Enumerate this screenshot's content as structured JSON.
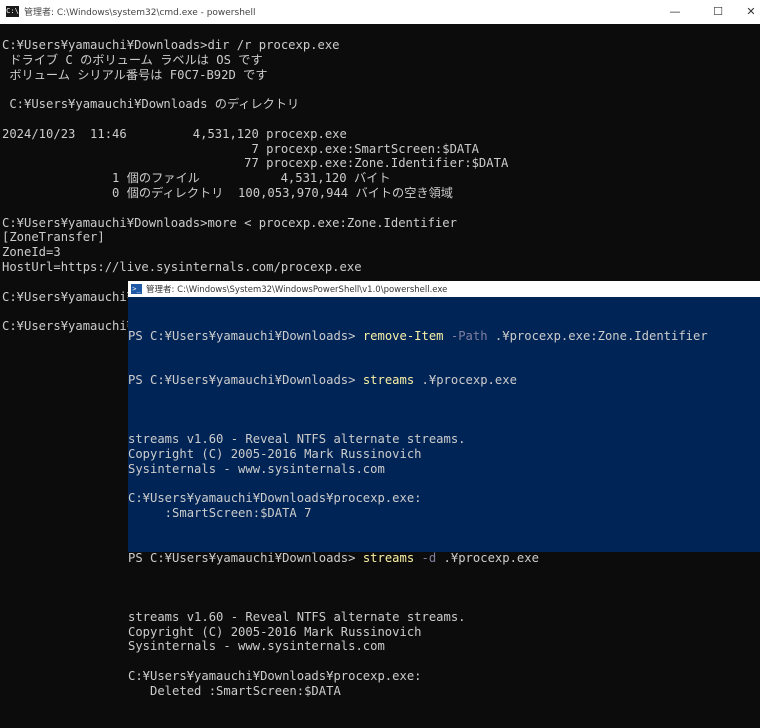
{
  "cmd": {
    "title": "管理者: C:\\Windows\\system32\\cmd.exe - powershell",
    "lines": [
      "C:¥Users¥yamauchi¥Downloads>dir /r procexp.exe",
      " ドライブ C のボリューム ラベルは OS です",
      " ボリューム シリアル番号は F0C7-B92D です",
      "",
      " C:¥Users¥yamauchi¥Downloads のディレクトリ",
      "",
      "2024/10/23  11:46         4,531,120 procexp.exe",
      "                                  7 procexp.exe:SmartScreen:$DATA",
      "                                 77 procexp.exe:Zone.Identifier:$DATA",
      "               1 個のファイル           4,531,120 バイト",
      "               0 個のディレクトリ  100,053,970,944 バイトの空き領域",
      "",
      "C:¥Users¥yamauchi¥Downloads>more < procexp.exe:Zone.Identifier",
      "[ZoneTransfer]",
      "ZoneId=3",
      "HostUrl=https://live.sysinternals.com/procexp.exe",
      "",
      "C:¥Users¥yamauchi¥Downloads>",
      "",
      "C:¥Users¥yamauchi¥Downloads>"
    ]
  },
  "ps": {
    "title": "管理者: C:\\Windows\\System32\\WindowsPowerShell\\v1.0\\powershell.exe",
    "prompt1": "PS C:¥Users¥yamauchi¥Downloads> ",
    "cmd1": "remove-Item",
    "param1": " -Path",
    "arg1": " .¥procexp.exe:Zone.Identifier",
    "prompt2": "PS C:¥Users¥yamauchi¥Downloads> ",
    "cmd2": "streams",
    "arg2": " .¥procexp.exe",
    "block1": [
      "",
      "streams v1.60 - Reveal NTFS alternate streams.",
      "Copyright (C) 2005-2016 Mark Russinovich",
      "Sysinternals - www.sysinternals.com",
      "",
      "C:¥Users¥yamauchi¥Downloads¥procexp.exe:",
      "     :SmartScreen:$DATA 7"
    ],
    "prompt3": "PS C:¥Users¥yamauchi¥Downloads> ",
    "cmd3": "streams",
    "param3": " -d",
    "arg3": " .¥procexp.exe",
    "block2": [
      "",
      "streams v1.60 - Reveal NTFS alternate streams.",
      "Copyright (C) 2005-2016 Mark Russinovich",
      "Sysinternals - www.sysinternals.com",
      "",
      "C:¥Users¥yamauchi¥Downloads¥procexp.exe:",
      "   Deleted :SmartScreen:$DATA"
    ]
  },
  "controls": {
    "minimize": "—",
    "maximize": "☐",
    "close": "✕"
  },
  "colors": {
    "cmd_bg": "#0c0c0c",
    "ps_bg": "#012456",
    "text": "#cccccc",
    "cmdlet": "#f9f1a5",
    "param": "#7f7f9f"
  }
}
